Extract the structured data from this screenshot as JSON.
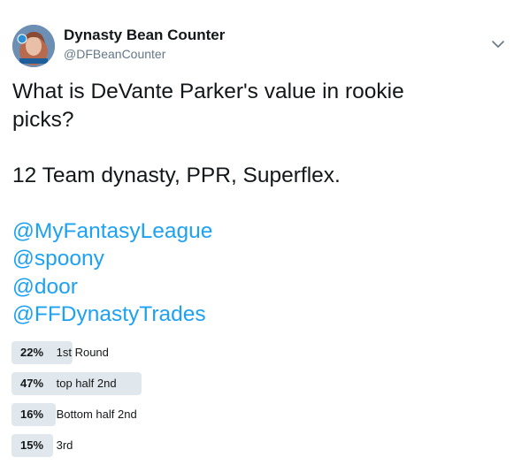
{
  "author": {
    "display_name": "Dynasty Bean Counter",
    "handle": "@DFBeanCounter"
  },
  "tweet": {
    "line1": "What is DeVante Parker's value in rookie",
    "line2": "picks?",
    "line3": "12 Team dynasty, PPR, Superflex.",
    "mentions": [
      "@MyFantasyLeague",
      "@spoony",
      "@door",
      "@FFDynastyTrades"
    ]
  },
  "poll": {
    "options": [
      {
        "percent": "22%",
        "label": "1st Round",
        "fraction": 0.22
      },
      {
        "percent": "47%",
        "label": "top half 2nd",
        "fraction": 0.47
      },
      {
        "percent": "16%",
        "label": "Bottom half 2nd",
        "fraction": 0.16
      },
      {
        "percent": "15%",
        "label": "3rd",
        "fraction": 0.15
      }
    ]
  },
  "icons": {
    "menu": "chevron-down-icon",
    "avatar": "profile-avatar"
  },
  "colors": {
    "mention": "#1da1f2",
    "poll_bar": "#e1e8ed"
  }
}
